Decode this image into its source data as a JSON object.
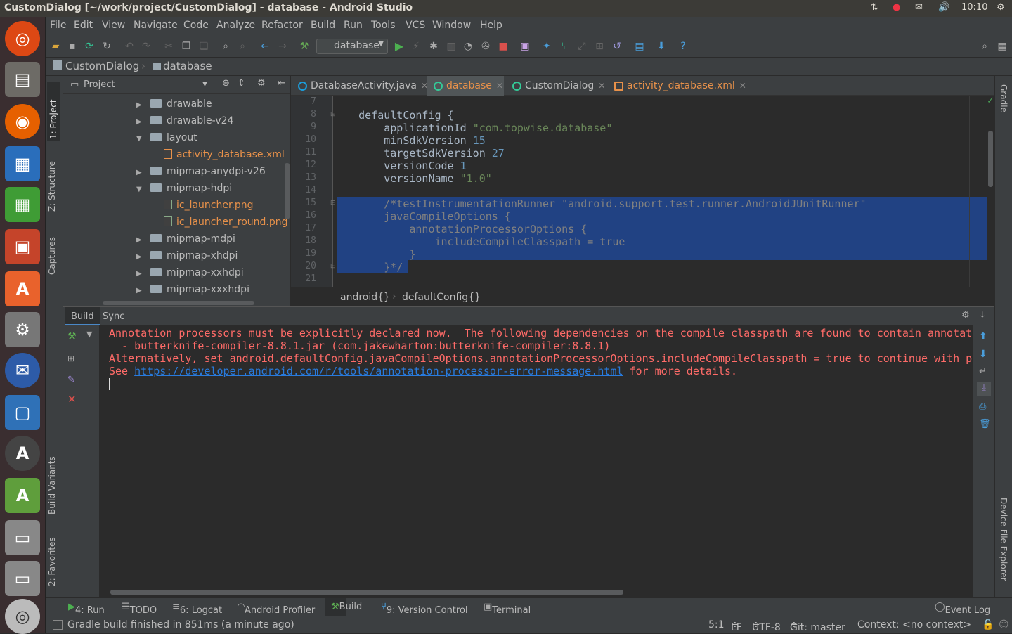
{
  "window_title": "CustomDialog [~/work/project/CustomDialog] - database - Android Studio",
  "top_bar": {
    "clock": "10:10"
  },
  "menu": [
    "File",
    "Edit",
    "View",
    "Navigate",
    "Code",
    "Analyze",
    "Refactor",
    "Build",
    "Run",
    "Tools",
    "VCS",
    "Window",
    "Help"
  ],
  "toolbar": {
    "run_config": "database"
  },
  "breadcrumb": {
    "project": "CustomDialog",
    "module": "database"
  },
  "project_panel": {
    "view": "Project",
    "tree": [
      {
        "label": "drawable",
        "type": "folder",
        "expanded": false
      },
      {
        "label": "drawable-v24",
        "type": "folder",
        "expanded": false
      },
      {
        "label": "layout",
        "type": "folder",
        "expanded": true
      },
      {
        "label": "activity_database.xml",
        "type": "xml"
      },
      {
        "label": "mipmap-anydpi-v26",
        "type": "folder",
        "expanded": false
      },
      {
        "label": "mipmap-hdpi",
        "type": "folder",
        "expanded": true
      },
      {
        "label": "ic_launcher.png",
        "type": "png"
      },
      {
        "label": "ic_launcher_round.png",
        "type": "png"
      },
      {
        "label": "mipmap-mdpi",
        "type": "folder",
        "expanded": false
      },
      {
        "label": "mipmap-xhdpi",
        "type": "folder",
        "expanded": false
      },
      {
        "label": "mipmap-xxhdpi",
        "type": "folder",
        "expanded": false
      },
      {
        "label": "mipmap-xxxhdpi",
        "type": "folder",
        "expanded": false
      }
    ]
  },
  "left_tool_tabs": [
    "1: Project",
    "Z: Structure",
    "Captures",
    "Build Variants",
    "2: Favorites"
  ],
  "right_tool_tabs": [
    "Gradle",
    "Device File Explorer"
  ],
  "editor_tabs": [
    {
      "label": "DatabaseActivity.java",
      "color": "#bbbbbb"
    },
    {
      "label": "database",
      "color": "#e8914a",
      "active": true
    },
    {
      "label": "CustomDialog",
      "color": "#bbbbbb"
    },
    {
      "label": "activity_database.xml",
      "color": "#e8914a"
    }
  ],
  "code": [
    {
      "n": "7",
      "text": ""
    },
    {
      "n": "8",
      "text": "    defaultConfig {"
    },
    {
      "n": "9",
      "text": "        applicationId \"com.topwise.database\""
    },
    {
      "n": "10",
      "text": "        minSdkVersion 15"
    },
    {
      "n": "11",
      "text": "        targetSdkVersion 27"
    },
    {
      "n": "12",
      "text": "        versionCode 1"
    },
    {
      "n": "13",
      "text": "        versionName \"1.0\""
    },
    {
      "n": "14",
      "text": ""
    },
    {
      "n": "15",
      "text": "        /*testInstrumentationRunner \"android.support.test.runner.AndroidJUnitRunner\""
    },
    {
      "n": "16",
      "text": "        javaCompileOptions {"
    },
    {
      "n": "17",
      "text": "            annotationProcessorOptions {"
    },
    {
      "n": "18",
      "text": "                includeCompileClasspath = true"
    },
    {
      "n": "19",
      "text": "            }"
    },
    {
      "n": "20",
      "text": "        }*/"
    },
    {
      "n": "21",
      "text": ""
    }
  ],
  "editor_breadcrumb": [
    "android{}",
    "defaultConfig{}"
  ],
  "build_panel": {
    "tabs": [
      "Build",
      "Sync"
    ],
    "lines": [
      "Annotation processors must be explicitly declared now.  The following dependencies on the compile classpath are found to contain annotati",
      "  - butterknife-compiler-8.8.1.jar (com.jakewharton:butterknife-compiler:8.8.1)",
      "Alternatively, set android.defaultConfig.javaCompileOptions.annotationProcessorOptions.includeCompileClasspath = true to continue with pr"
    ],
    "see_prefix": "See ",
    "link": "https://developer.android.com/r/tools/annotation-processor-error-message.html",
    "see_suffix": " for more details."
  },
  "tool_windows": [
    "4: Run",
    "TODO",
    "6: Logcat",
    "Android Profiler",
    "Build",
    "9: Version Control",
    "Terminal"
  ],
  "event_log": "Event Log",
  "status": {
    "message": "Gradle build finished in 851ms (a minute ago)",
    "position": "5:1",
    "line_sep": "LF",
    "encoding": "UTF-8",
    "git": "Git: master",
    "context": "Context: <no context>"
  }
}
